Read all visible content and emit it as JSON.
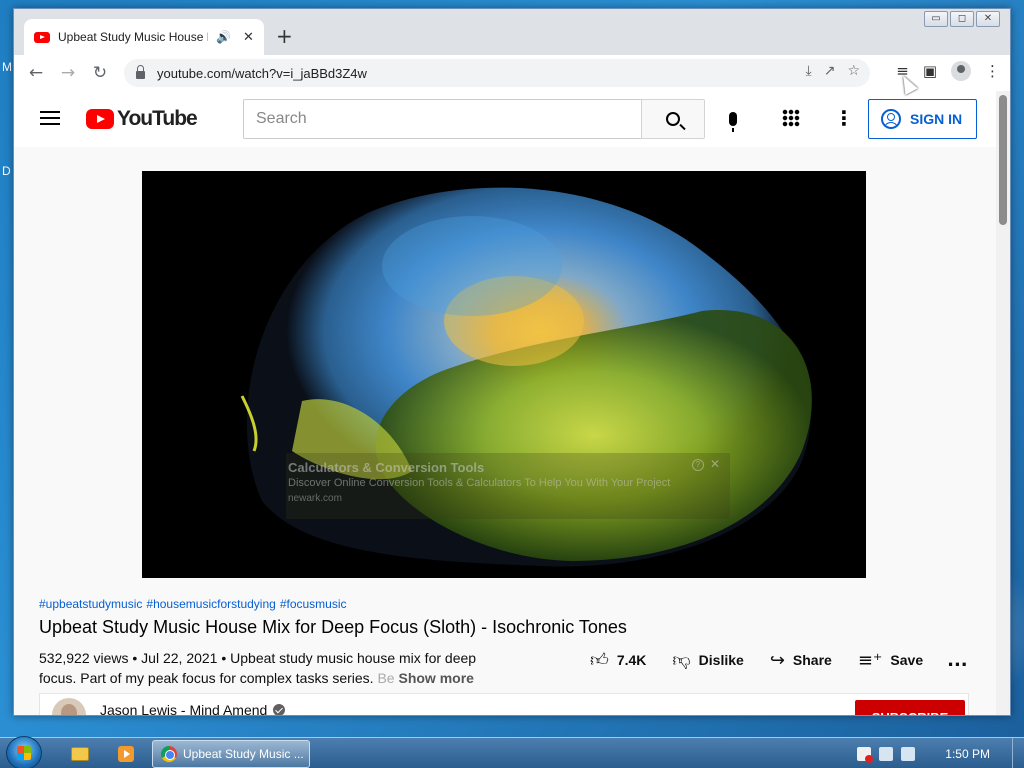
{
  "desktop": {
    "edge_letters": [
      "M",
      "D"
    ]
  },
  "browser": {
    "tab_title": "Upbeat Study Music House Mix for Deep Focus (Sloth) - Isochronic Tones - YouTube",
    "tab_audio_icon": "speaker-icon",
    "url": "youtube.com/watch?v=i_jaBBd3Z4w",
    "window_controls": {
      "minimize": "▭",
      "maximize": "◻",
      "close": "✕"
    }
  },
  "youtube": {
    "logo_text": "YouTube",
    "search_placeholder": "Search",
    "sign_in_label": "SIGN IN",
    "accent": "#065fd4",
    "brand_red": "#ff0000"
  },
  "ad": {
    "title": "Calculators & Conversion Tools",
    "description": "Discover Online Conversion Tools & Calculators To Help You With Your Project",
    "domain": "newark.com",
    "info": "?",
    "close": "✕"
  },
  "video": {
    "hashtags": [
      "#upbeatstudymusic",
      "#housemusicforstudying",
      "#focusmusic"
    ],
    "title": "Upbeat Study Music House Mix for Deep Focus (Sloth) - Isochronic Tones",
    "description_line1": "532,922 views • Jul 22, 2021 • Upbeat study music house mix for deep",
    "description_line2": "focus.  Part of my peak focus for complex tasks series.",
    "description_fade": "Be",
    "show_more": "Show more",
    "likes": "7.4K",
    "dislike_label": "Dislike",
    "share_label": "Share",
    "save_label": "Save",
    "more_label": "..."
  },
  "channel": {
    "name": "Jason Lewis - Mind Amend",
    "subscribe_label": "SUBSCRIBE"
  },
  "taskbar": {
    "task_label": "Upbeat Study Music ...",
    "clock": "1:50 PM"
  }
}
